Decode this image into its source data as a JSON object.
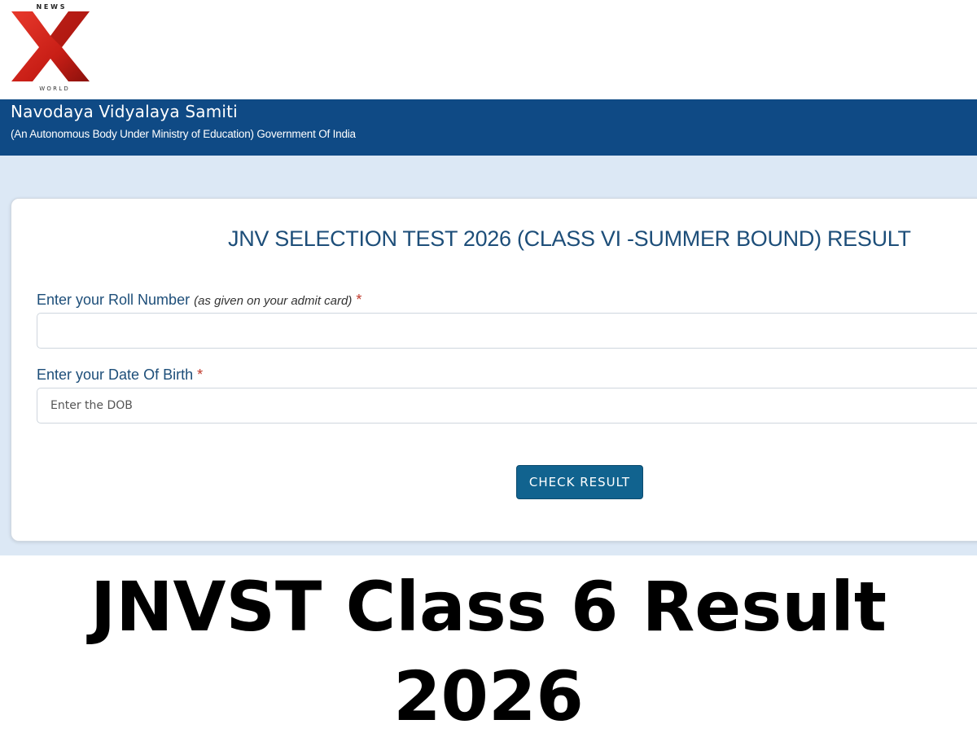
{
  "logo": {
    "top_text": "N E W S",
    "bottom_text": "W O R L D",
    "mark": "X",
    "colors": {
      "primary": "#d0271d",
      "dark": "#7a0d0a"
    }
  },
  "header": {
    "title": "Navodaya Vidyalaya Samiti",
    "subtitle": "(An Autonomous Body Under Ministry of Education) Government Of India",
    "background": "#0f4a85"
  },
  "form": {
    "heading": "JNV SELECTION TEST 2026 (CLASS VI -SUMMER BOUND) RESULT",
    "roll_number": {
      "label": "Enter your Roll Number",
      "hint": "(as given on your admit card)",
      "required_mark": "*",
      "value": "",
      "placeholder": ""
    },
    "dob": {
      "label": "Enter your Date Of Birth",
      "required_mark": "*",
      "value": "",
      "placeholder": "Enter the DOB"
    },
    "submit_label": "CHECK RESULT",
    "accent": "#11638f"
  },
  "caption": {
    "line1": "JNVST Class 6 Result",
    "line2": "2026"
  }
}
